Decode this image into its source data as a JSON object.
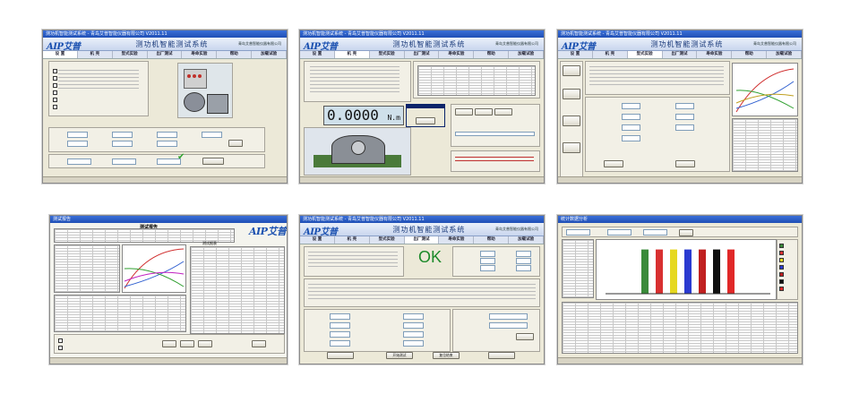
{
  "common": {
    "app_title": "测功机智能测试系统",
    "company": "青岛艾普智能仪器有限公司",
    "logo": "AIP艾普",
    "tabs": [
      "设 置",
      "机 壳",
      "型式实验",
      "出厂测试",
      "寿命实验",
      "帮助",
      "加载试验"
    ]
  },
  "s1": {
    "window_title": "测功机智能测试系统 - 青岛艾普智能仪器有限公司 V2011.11"
  },
  "s2": {
    "window_title": "测功机智能测试系统 - 青岛艾普智能仪器有限公司 V2011.11",
    "reading": "0.0000",
    "unit": "N.m"
  },
  "s3": {
    "window_title": "测功机智能测试系统 - 青岛艾普智能仪器有限公司 V2011.11"
  },
  "s4": {
    "window_title": "测试报告",
    "report_title": "测试报告",
    "sub_title": "测试报表"
  },
  "s5": {
    "window_title": "测功机智能测试系统 - 青岛艾普智能仪器有限公司 V2011.11",
    "ok_text": "OK",
    "start_button": "开始测试",
    "reset_button": "复位结束"
  },
  "s6": {
    "window_title": "统计数据分析"
  },
  "chart_data": {
    "type": "bar",
    "categories": [
      "1",
      "2",
      "3",
      "4",
      "5",
      "6",
      "7"
    ],
    "values": [
      95,
      95,
      95,
      95,
      95,
      95,
      95
    ],
    "colors": [
      "#3a8a3a",
      "#d83030",
      "#e6d820",
      "#2a3ad0",
      "#c02020",
      "#101010",
      "#e02828"
    ],
    "title": "",
    "xlabel": "",
    "ylabel": ""
  }
}
